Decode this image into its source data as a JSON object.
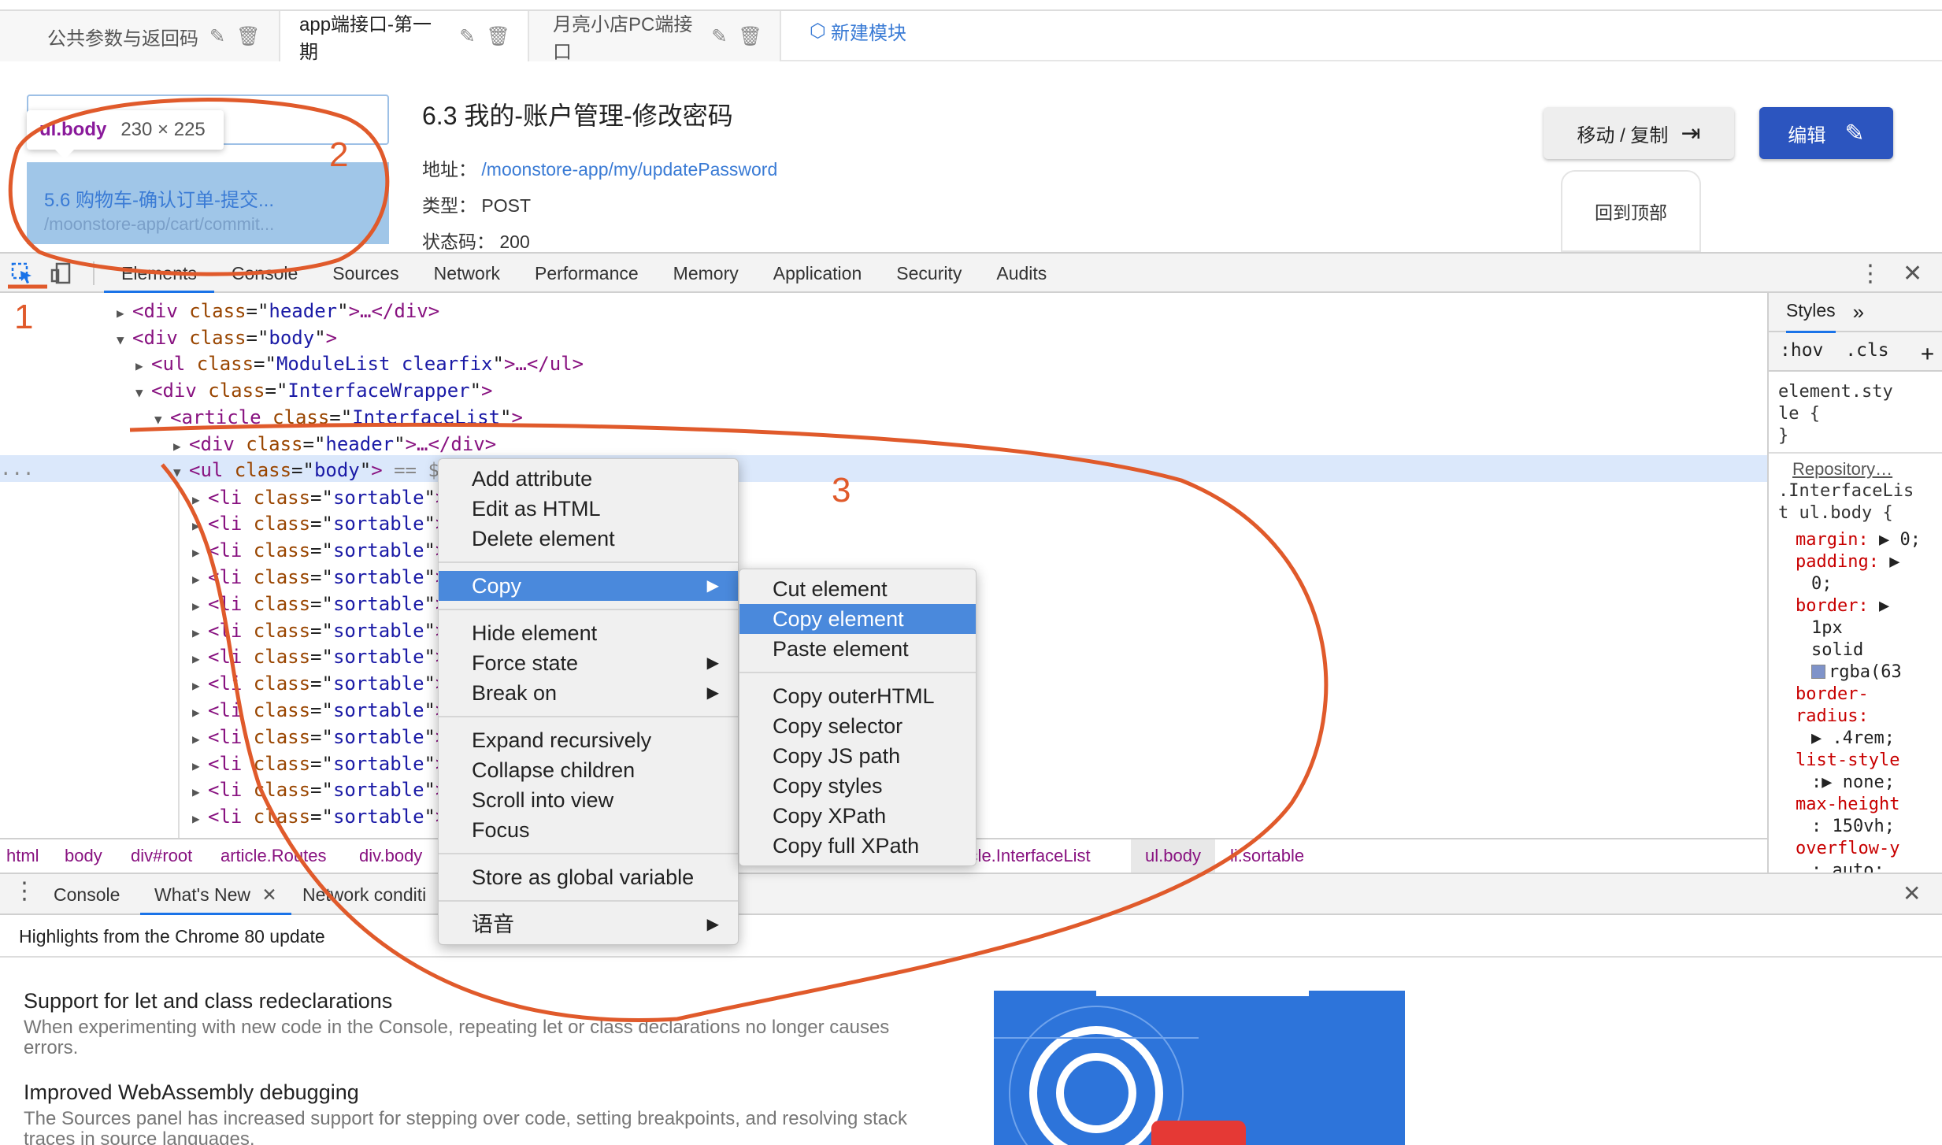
{
  "top_tabs": [
    {
      "label": "公共参数与返回码"
    },
    {
      "label": "app端接口-第一期"
    },
    {
      "label": "月亮小店PC端接口"
    }
  ],
  "new_module": "新建模块",
  "tooltip": {
    "selector": "ul.body",
    "size": "230 × 225"
  },
  "highlighted_item": {
    "title": "5.6 购物车-确认订单-提交...",
    "path": "/moonstore-app/cart/commit..."
  },
  "api": {
    "title": "6.3 我的-账户管理-修改密码",
    "address_label": "地址：",
    "address": "/moonstore-app/my/updatePassword",
    "type_label": "类型：",
    "type": "POST",
    "status_label": "状态码：",
    "status": "200"
  },
  "buttons": {
    "move_copy": "移动 / 复制",
    "edit": "编辑",
    "back_top": "回到顶部"
  },
  "devtools": {
    "tabs": [
      "Elements",
      "Console",
      "Sources",
      "Network",
      "Performance",
      "Memory",
      "Application",
      "Security",
      "Audits"
    ],
    "active_tab": "Elements"
  },
  "dom_lines": [
    {
      "tri": "▶",
      "tag": "div",
      "cls": "header",
      "tail": "…</div>"
    },
    {
      "tri": "▼",
      "tag": "div",
      "cls": "body",
      "tail": ""
    },
    {
      "tri": "▶",
      "tag": "ul",
      "cls": "ModuleList clearfix",
      "tail": "…</ul>"
    },
    {
      "tri": "▼",
      "tag": "div",
      "cls": "InterfaceWrapper",
      "tail": ""
    },
    {
      "tri": "▼",
      "tag": "article",
      "cls": "InterfaceList",
      "tail": ""
    },
    {
      "tri": "▶",
      "tag": "div",
      "cls": "header",
      "tail": "…</div>"
    },
    {
      "tri": "▼",
      "tag": "ul",
      "cls": "body",
      "tail": " == $0"
    }
  ],
  "li_line": {
    "tag": "li",
    "cls": "sortable"
  },
  "dom_ellipsis": "...",
  "styles": {
    "tab": "Styles",
    "hov": ":hov",
    "cls": ".cls",
    "element_style_1": "element.sty",
    "element_style_2": "le {",
    "close_brace": "}",
    "source": "Repository…",
    "selector_1": ".InterfaceLis",
    "selector_2": "t ul.body {",
    "decls": [
      {
        "text": "margin:",
        "value": "▶ 0;"
      },
      {
        "text": "padding:",
        "value": "▶"
      },
      {
        "text": "",
        "value": "0;"
      },
      {
        "text": "border:",
        "value": "▶"
      },
      {
        "text": "",
        "value": "1px"
      },
      {
        "text": "",
        "value": "solid"
      },
      {
        "text": "",
        "value": "rgba(63"
      },
      {
        "text": "border-",
        "value": ""
      },
      {
        "text": "  radius:",
        "value": ""
      },
      {
        "text": "",
        "value": "▶ .4rem;"
      },
      {
        "text": "list-style",
        "value": ""
      },
      {
        "text": "",
        "value": ":▶ none;"
      },
      {
        "text": "max-height",
        "value": ""
      },
      {
        "text": "",
        "value": ": 150vh;"
      },
      {
        "text": "overflow-y",
        "value": ""
      },
      {
        "text": "",
        "value": ": auto;"
      }
    ]
  },
  "breadcrumbs": [
    "html",
    "body",
    "div#root",
    "article.Routes",
    "div.body",
    "article.InterfaceList",
    "ul.body",
    "li.sortable"
  ],
  "drawer": {
    "tabs": [
      "Console",
      "What's New",
      "Network conditi"
    ],
    "active": "What's New"
  },
  "whats_new": {
    "header": "Highlights from the Chrome 80 update",
    "items": [
      {
        "title": "Support for let and class redeclarations",
        "body": "When experimenting with new code in the Console, repeating let or class declarations no longer causes errors."
      },
      {
        "title": "Improved WebAssembly debugging",
        "body": "The Sources panel has increased support for stepping over code, setting breakpoints, and resolving stack traces in source languages."
      }
    ]
  },
  "context_menu": [
    {
      "label": "Add attribute"
    },
    {
      "label": "Edit as HTML"
    },
    {
      "label": "Delete element"
    },
    {
      "sep": true
    },
    {
      "label": "Copy",
      "submenu": true,
      "selected": true
    },
    {
      "sep": true
    },
    {
      "label": "Hide element"
    },
    {
      "label": "Force state",
      "submenu": true
    },
    {
      "label": "Break on",
      "submenu": true
    },
    {
      "sep": true
    },
    {
      "label": "Expand recursively"
    },
    {
      "label": "Collapse children"
    },
    {
      "label": "Scroll into view"
    },
    {
      "label": "Focus"
    },
    {
      "sep": true
    },
    {
      "label": "Store as global variable"
    },
    {
      "sep": true
    },
    {
      "label": "语音",
      "submenu": true
    }
  ],
  "copy_submenu": [
    {
      "label": "Cut element"
    },
    {
      "label": "Copy element",
      "selected": true
    },
    {
      "label": "Paste element"
    },
    {
      "sep": true
    },
    {
      "label": "Copy outerHTML"
    },
    {
      "label": "Copy selector"
    },
    {
      "label": "Copy JS path"
    },
    {
      "label": "Copy styles"
    },
    {
      "label": "Copy XPath"
    },
    {
      "label": "Copy full XPath"
    }
  ],
  "annotations": {
    "n1": "1",
    "n2": "2",
    "n3": "3",
    "color": "#e05a2b"
  },
  "colors": {
    "accent": "#2c55bf",
    "link": "#3a7bd5",
    "menu_selected": "#4a89dc"
  }
}
